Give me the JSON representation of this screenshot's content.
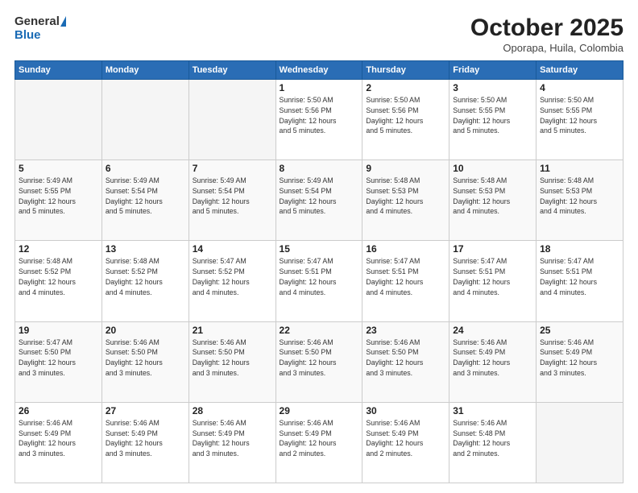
{
  "header": {
    "logo_general": "General",
    "logo_blue": "Blue",
    "month_title": "October 2025",
    "subtitle": "Oporapa, Huila, Colombia"
  },
  "weekdays": [
    "Sunday",
    "Monday",
    "Tuesday",
    "Wednesday",
    "Thursday",
    "Friday",
    "Saturday"
  ],
  "weeks": [
    [
      {
        "day": "",
        "info": ""
      },
      {
        "day": "",
        "info": ""
      },
      {
        "day": "",
        "info": ""
      },
      {
        "day": "1",
        "info": "Sunrise: 5:50 AM\nSunset: 5:56 PM\nDaylight: 12 hours\nand 5 minutes."
      },
      {
        "day": "2",
        "info": "Sunrise: 5:50 AM\nSunset: 5:56 PM\nDaylight: 12 hours\nand 5 minutes."
      },
      {
        "day": "3",
        "info": "Sunrise: 5:50 AM\nSunset: 5:55 PM\nDaylight: 12 hours\nand 5 minutes."
      },
      {
        "day": "4",
        "info": "Sunrise: 5:50 AM\nSunset: 5:55 PM\nDaylight: 12 hours\nand 5 minutes."
      }
    ],
    [
      {
        "day": "5",
        "info": "Sunrise: 5:49 AM\nSunset: 5:55 PM\nDaylight: 12 hours\nand 5 minutes."
      },
      {
        "day": "6",
        "info": "Sunrise: 5:49 AM\nSunset: 5:54 PM\nDaylight: 12 hours\nand 5 minutes."
      },
      {
        "day": "7",
        "info": "Sunrise: 5:49 AM\nSunset: 5:54 PM\nDaylight: 12 hours\nand 5 minutes."
      },
      {
        "day": "8",
        "info": "Sunrise: 5:49 AM\nSunset: 5:54 PM\nDaylight: 12 hours\nand 5 minutes."
      },
      {
        "day": "9",
        "info": "Sunrise: 5:48 AM\nSunset: 5:53 PM\nDaylight: 12 hours\nand 4 minutes."
      },
      {
        "day": "10",
        "info": "Sunrise: 5:48 AM\nSunset: 5:53 PM\nDaylight: 12 hours\nand 4 minutes."
      },
      {
        "day": "11",
        "info": "Sunrise: 5:48 AM\nSunset: 5:53 PM\nDaylight: 12 hours\nand 4 minutes."
      }
    ],
    [
      {
        "day": "12",
        "info": "Sunrise: 5:48 AM\nSunset: 5:52 PM\nDaylight: 12 hours\nand 4 minutes."
      },
      {
        "day": "13",
        "info": "Sunrise: 5:48 AM\nSunset: 5:52 PM\nDaylight: 12 hours\nand 4 minutes."
      },
      {
        "day": "14",
        "info": "Sunrise: 5:47 AM\nSunset: 5:52 PM\nDaylight: 12 hours\nand 4 minutes."
      },
      {
        "day": "15",
        "info": "Sunrise: 5:47 AM\nSunset: 5:51 PM\nDaylight: 12 hours\nand 4 minutes."
      },
      {
        "day": "16",
        "info": "Sunrise: 5:47 AM\nSunset: 5:51 PM\nDaylight: 12 hours\nand 4 minutes."
      },
      {
        "day": "17",
        "info": "Sunrise: 5:47 AM\nSunset: 5:51 PM\nDaylight: 12 hours\nand 4 minutes."
      },
      {
        "day": "18",
        "info": "Sunrise: 5:47 AM\nSunset: 5:51 PM\nDaylight: 12 hours\nand 4 minutes."
      }
    ],
    [
      {
        "day": "19",
        "info": "Sunrise: 5:47 AM\nSunset: 5:50 PM\nDaylight: 12 hours\nand 3 minutes."
      },
      {
        "day": "20",
        "info": "Sunrise: 5:46 AM\nSunset: 5:50 PM\nDaylight: 12 hours\nand 3 minutes."
      },
      {
        "day": "21",
        "info": "Sunrise: 5:46 AM\nSunset: 5:50 PM\nDaylight: 12 hours\nand 3 minutes."
      },
      {
        "day": "22",
        "info": "Sunrise: 5:46 AM\nSunset: 5:50 PM\nDaylight: 12 hours\nand 3 minutes."
      },
      {
        "day": "23",
        "info": "Sunrise: 5:46 AM\nSunset: 5:50 PM\nDaylight: 12 hours\nand 3 minutes."
      },
      {
        "day": "24",
        "info": "Sunrise: 5:46 AM\nSunset: 5:49 PM\nDaylight: 12 hours\nand 3 minutes."
      },
      {
        "day": "25",
        "info": "Sunrise: 5:46 AM\nSunset: 5:49 PM\nDaylight: 12 hours\nand 3 minutes."
      }
    ],
    [
      {
        "day": "26",
        "info": "Sunrise: 5:46 AM\nSunset: 5:49 PM\nDaylight: 12 hours\nand 3 minutes."
      },
      {
        "day": "27",
        "info": "Sunrise: 5:46 AM\nSunset: 5:49 PM\nDaylight: 12 hours\nand 3 minutes."
      },
      {
        "day": "28",
        "info": "Sunrise: 5:46 AM\nSunset: 5:49 PM\nDaylight: 12 hours\nand 3 minutes."
      },
      {
        "day": "29",
        "info": "Sunrise: 5:46 AM\nSunset: 5:49 PM\nDaylight: 12 hours\nand 2 minutes."
      },
      {
        "day": "30",
        "info": "Sunrise: 5:46 AM\nSunset: 5:49 PM\nDaylight: 12 hours\nand 2 minutes."
      },
      {
        "day": "31",
        "info": "Sunrise: 5:46 AM\nSunset: 5:48 PM\nDaylight: 12 hours\nand 2 minutes."
      },
      {
        "day": "",
        "info": ""
      }
    ]
  ]
}
